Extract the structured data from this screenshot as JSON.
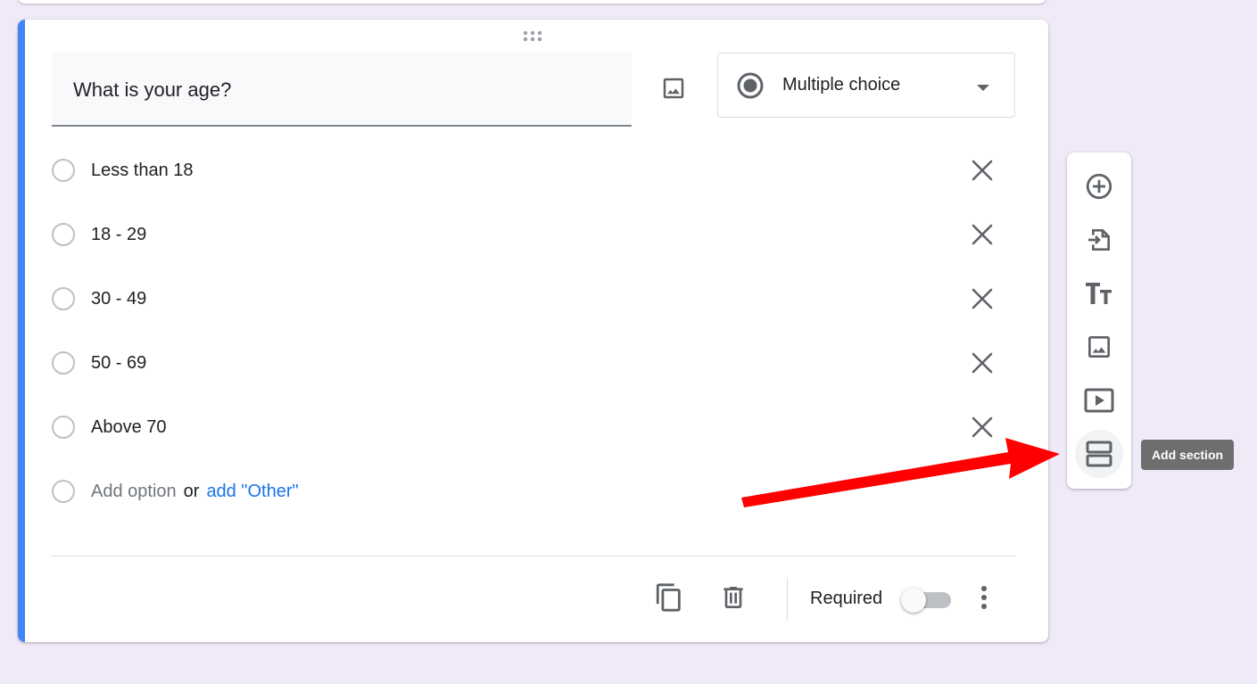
{
  "question": {
    "title": "What is your age?",
    "type_label": "Multiple choice",
    "options": [
      {
        "label": "Less than 18"
      },
      {
        "label": "18 - 29"
      },
      {
        "label": "30 - 49"
      },
      {
        "label": "50 - 69"
      },
      {
        "label": "Above 70"
      }
    ],
    "add_option": "Add option",
    "or_text": "or",
    "add_other": "add \"Other\"",
    "required_label": "Required",
    "required_on": false
  },
  "toolbar": {
    "tooltip": "Add section",
    "items": [
      {
        "icon": "add-circle-icon"
      },
      {
        "icon": "import-questions-icon"
      },
      {
        "icon": "title-text-icon"
      },
      {
        "icon": "image-icon"
      },
      {
        "icon": "video-icon"
      },
      {
        "icon": "section-icon"
      }
    ]
  },
  "colors": {
    "accent": "#4285f4",
    "link": "#1a73e8",
    "background": "#efe9f8",
    "annotation_arrow": "#ff0000"
  }
}
